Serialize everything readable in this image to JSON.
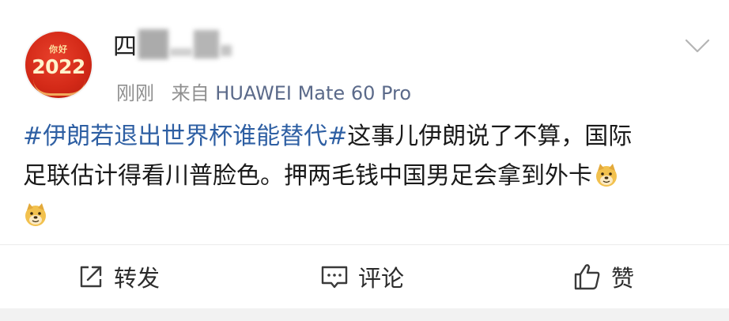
{
  "post": {
    "author": {
      "name_visible_char": "四",
      "avatar": {
        "top_text": "你好",
        "year": "2022"
      }
    },
    "time": "刚刚",
    "source_prefix": "来自",
    "source_device": "HUAWEI Mate 60 Pro",
    "hashtag": "#伊朗若退出世界杯谁能替代#",
    "body_line1": "这事儿伊朗说了不算，国际",
    "body_line2": "足联估计得看川普脸色。押两毛钱中国男足会拿到外卡",
    "emoji": "doge-emoji"
  },
  "actions": {
    "repost_label": "转发",
    "comment_label": "评论",
    "like_label": "赞"
  },
  "icons": {
    "repost": "share-icon",
    "comment": "comment-icon",
    "like": "thumbs-up-icon",
    "more": "chevron-down-icon"
  },
  "colors": {
    "hashtag": "#2e5fa3",
    "meta_text": "#8f8f8f",
    "device_text": "#5b6a8a",
    "avatar_red": "#d42a18",
    "avatar_gold": "#fde3a1"
  }
}
